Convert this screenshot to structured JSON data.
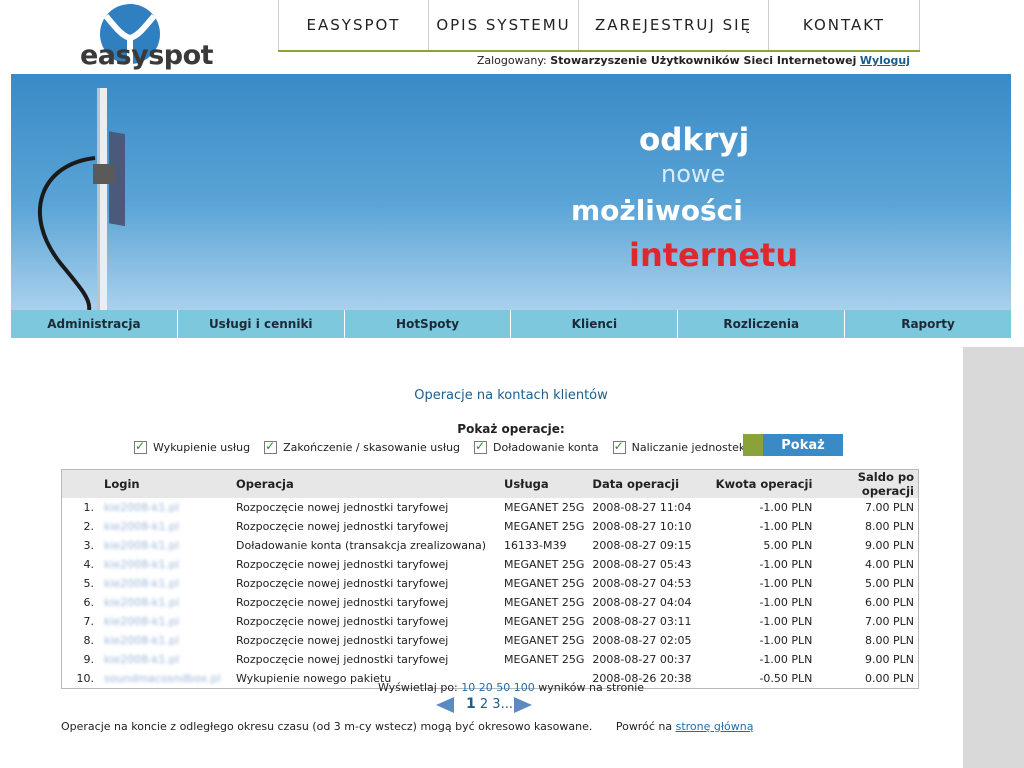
{
  "header": {
    "logo_text": "easyspot",
    "nav": [
      "EASYSPOT",
      "OPIS SYSTEMU",
      "ZAREJESTRUJ SIĘ",
      "KONTAKT"
    ],
    "logged_label": "Zalogowany:",
    "logged_user": "Stowarzyszenie Użytkowników Sieci Internetowej",
    "logout_label": "Wyloguj"
  },
  "banner": {
    "line1": "odkryj",
    "line2": "nowe",
    "line3": "możliwości",
    "line4": "internetu"
  },
  "mainmenu": [
    "Administracja",
    "Usługi i cenniki",
    "HotSpoty",
    "Klienci",
    "Rozliczenia",
    "Raporty"
  ],
  "page": {
    "title": "Operacje na kontach klientów",
    "filters_label": "Pokaż operacje:",
    "filters": [
      "Wykupienie usług",
      "Zakończenie / skasowanie usług",
      "Doładowanie konta",
      "Naliczanie jednostek bilingowych"
    ],
    "show_button": "Pokaż"
  },
  "table": {
    "headers": [
      "",
      "Login",
      "Operacja",
      "Usługa",
      "Data operacji",
      "Kwota operacji",
      "Saldo po operacji"
    ],
    "rows": [
      {
        "num": "1.",
        "login": "kie2008-k1.pl",
        "op": "Rozpoczęcie nowej jednostki taryfowej",
        "service": "MEGANET 25G",
        "date": "2008-08-27 11:04",
        "amount": "-1.00 PLN",
        "balance": "7.00 PLN"
      },
      {
        "num": "2.",
        "login": "kie2008-k1.pl",
        "op": "Rozpoczęcie nowej jednostki taryfowej",
        "service": "MEGANET 25G",
        "date": "2008-08-27 10:10",
        "amount": "-1.00 PLN",
        "balance": "8.00 PLN"
      },
      {
        "num": "3.",
        "login": "kie2008-k1.pl",
        "op": "Doładowanie konta (transakcja zrealizowana)",
        "service": "16133-M39",
        "date": "2008-08-27 09:15",
        "amount": "5.00 PLN",
        "balance": "9.00 PLN"
      },
      {
        "num": "4.",
        "login": "kie2008-k1.pl",
        "op": "Rozpoczęcie nowej jednostki taryfowej",
        "service": "MEGANET 25G",
        "date": "2008-08-27 05:43",
        "amount": "-1.00 PLN",
        "balance": "4.00 PLN"
      },
      {
        "num": "5.",
        "login": "kie2008-k1.pl",
        "op": "Rozpoczęcie nowej jednostki taryfowej",
        "service": "MEGANET 25G",
        "date": "2008-08-27 04:53",
        "amount": "-1.00 PLN",
        "balance": "5.00 PLN"
      },
      {
        "num": "6.",
        "login": "kie2008-k1.pl",
        "op": "Rozpoczęcie nowej jednostki taryfowej",
        "service": "MEGANET 25G",
        "date": "2008-08-27 04:04",
        "amount": "-1.00 PLN",
        "balance": "6.00 PLN"
      },
      {
        "num": "7.",
        "login": "kie2008-k1.pl",
        "op": "Rozpoczęcie nowej jednostki taryfowej",
        "service": "MEGANET 25G",
        "date": "2008-08-27 03:11",
        "amount": "-1.00 PLN",
        "balance": "7.00 PLN"
      },
      {
        "num": "8.",
        "login": "kie2008-k1.pl",
        "op": "Rozpoczęcie nowej jednostki taryfowej",
        "service": "MEGANET 25G",
        "date": "2008-08-27 02:05",
        "amount": "-1.00 PLN",
        "balance": "8.00 PLN"
      },
      {
        "num": "9.",
        "login": "kie2008-k1.pl",
        "op": "Rozpoczęcie nowej jednostki taryfowej",
        "service": "MEGANET 25G",
        "date": "2008-08-27 00:37",
        "amount": "-1.00 PLN",
        "balance": "9.00 PLN"
      },
      {
        "num": "10.",
        "login": "soundmacosndbox.pl",
        "op": "Wykupienie nowego pakietu",
        "service": "",
        "date": "2008-08-26 20:38",
        "amount": "-0.50 PLN",
        "balance": "0.00 PLN"
      }
    ]
  },
  "pagination": {
    "prefix": "Wyświetlaj po:",
    "sizes": [
      "10",
      "20",
      "50",
      "100"
    ],
    "suffix": "wyników na stronie",
    "current": "1",
    "others": "2 3..."
  },
  "footer": {
    "note": "Operacje na koncie z odległego okresu czasu (od 3 m-cy wstecz) mogą być okresowo kasowane.",
    "back_prefix": "Powróć na",
    "back_link": "stronę główną"
  },
  "colors": {
    "accent_blue": "#3a8ac6",
    "menu_bar": "#7ec8de",
    "accent_green": "#8aa23a",
    "banner_red": "#e0262f"
  }
}
